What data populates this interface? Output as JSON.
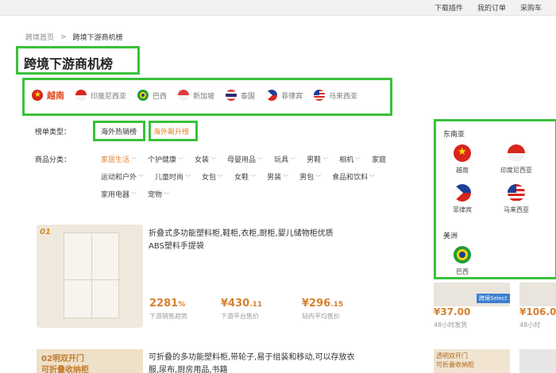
{
  "topbar": {
    "links": [
      "下载插件",
      "我的订单",
      "采购车"
    ]
  },
  "breadcrumb": {
    "home": "跨境首页",
    "separator": ">",
    "current": "跨境下游商机榜"
  },
  "page": {
    "title": "跨境下游商机榜"
  },
  "countries": [
    {
      "label": "越南",
      "flag": "vietnam",
      "active": true
    },
    {
      "label": "印度尼西亚",
      "flag": "indonesia",
      "active": false
    },
    {
      "label": "巴西",
      "flag": "brazil",
      "active": false
    },
    {
      "label": "新加坡",
      "flag": "singapore",
      "active": false
    },
    {
      "label": "泰国",
      "flag": "thailand",
      "active": false
    },
    {
      "label": "菲律宾",
      "flag": "philippines",
      "active": false
    },
    {
      "label": "马来西亚",
      "flag": "malaysia",
      "active": false
    }
  ],
  "rank_type": {
    "label": "榜单类型：",
    "options": [
      "海外热销榜",
      "海外飙升榜"
    ]
  },
  "category": {
    "label": "商品分类：",
    "rows": [
      [
        "家居生活",
        "个护健康",
        "女装",
        "母婴用品",
        "玩具",
        "男鞋",
        "相机",
        "家庭"
      ],
      [
        "运动和户外",
        "儿童时尚",
        "女包",
        "女鞋",
        "男装",
        "男包",
        "食品和饮料"
      ],
      [
        "家用电器",
        "宠物"
      ]
    ],
    "active": "家居生活"
  },
  "region_panel": {
    "groups": [
      {
        "name": "东南亚",
        "items": [
          {
            "label": "越南",
            "flag": "vietnam"
          },
          {
            "label": "印度尼西亚",
            "flag": "indonesia"
          },
          {
            "label": "菲律宾",
            "flag": "philippines"
          },
          {
            "label": "马来西亚",
            "flag": "malaysia"
          }
        ]
      },
      {
        "name": "美洲",
        "items": [
          {
            "label": "巴西",
            "flag": "brazil"
          }
        ]
      }
    ]
  },
  "products": [
    {
      "rank": "01",
      "title": "折叠式多功能塑料柜,鞋柜,衣柜,厨柜,婴儿储物柜优质ABS塑料手提袋",
      "sales": {
        "value": "2281",
        "unit": "%",
        "label": "下游销售趋势"
      },
      "platform_price": {
        "value": "¥430",
        "decimal": ".11",
        "label": "下游平台售价"
      },
      "site_price": {
        "value": "¥296",
        "decimal": ".15",
        "label": "站内平均售价"
      }
    },
    {
      "rank": "02",
      "image_text": [
        "明双开门",
        "可折叠收纳柜"
      ],
      "title": "可折叠的多功能塑料柜,带轮子,易于组装和移动,可以存放衣服,尿布,厨房用品,书籍"
    }
  ],
  "side_items": {
    "tag": "跨境Select",
    "prices": [
      "¥37.00",
      "¥106.0"
    ],
    "ship": [
      "48小时发货",
      "48小时"
    ],
    "card_text": [
      "透明双开门",
      "可折叠收纳柜"
    ]
  },
  "colors": {
    "accent_orange": "#d6812f",
    "highlight_green": "#39c23a",
    "active_red": "#e24a1f"
  }
}
